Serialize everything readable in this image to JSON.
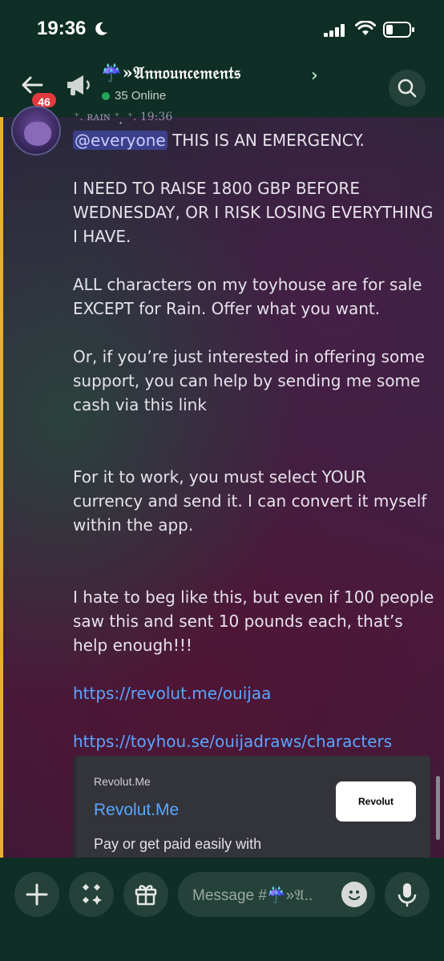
{
  "status_bar": {
    "time": "19:36"
  },
  "header": {
    "back_badge": "46",
    "channel_title": "☔»𝔄𝔫𝔫𝔬𝔲𝔫𝔠𝔢𝔪𝔢𝔫𝔱𝔰",
    "chevron": "›",
    "online_text": "35 Online"
  },
  "message": {
    "author_cut": "⁺. ʀᴀɪɴ ⁺  ̟ ⁺.       19:36",
    "mention": "@everyone",
    "line1": " THIS IS AN EMERGENCY.",
    "para2": "I NEED TO RAISE 1800 GBP BEFORE WEDNESDAY, OR I RISK LOSING EVERYTHING I HAVE.",
    "para3": "ALL characters on my toyhouse are for sale EXCEPT for Rain. Offer what you want.",
    "para4": "Or, if you’re just interested in offering some support, you can help by sending me some cash via this link",
    "para5": "For it to work, you must select YOUR currency and send it. I can convert it myself within the app.",
    "para6": "I hate to beg like this, but even if 100 people saw this and sent 10 pounds each, that’s help enough!!!",
    "link1": "https://revolut.me/ouijaa",
    "link2": "https://toyhou.se/ouijadraws/characters"
  },
  "embed": {
    "provider": "Revolut.Me",
    "title": "Revolut.Me",
    "description": "Pay or get paid easily with",
    "thumb_text": "Revolut"
  },
  "composer": {
    "placeholder": "Message #☔»𝔄.."
  },
  "colors": {
    "accent_link": "#5aa6ff",
    "online": "#23a55a",
    "badge": "#e23a3f",
    "mention_bg": "#3c3f8a",
    "side_bar": "#e8b02c"
  },
  "icons": {
    "back": "arrow-left-icon",
    "megaphone": "megaphone-icon",
    "search": "search-icon",
    "plus": "plus-icon",
    "apps": "apps-icon",
    "gift": "gift-icon",
    "emoji": "emoji-icon",
    "mic": "microphone-icon"
  }
}
